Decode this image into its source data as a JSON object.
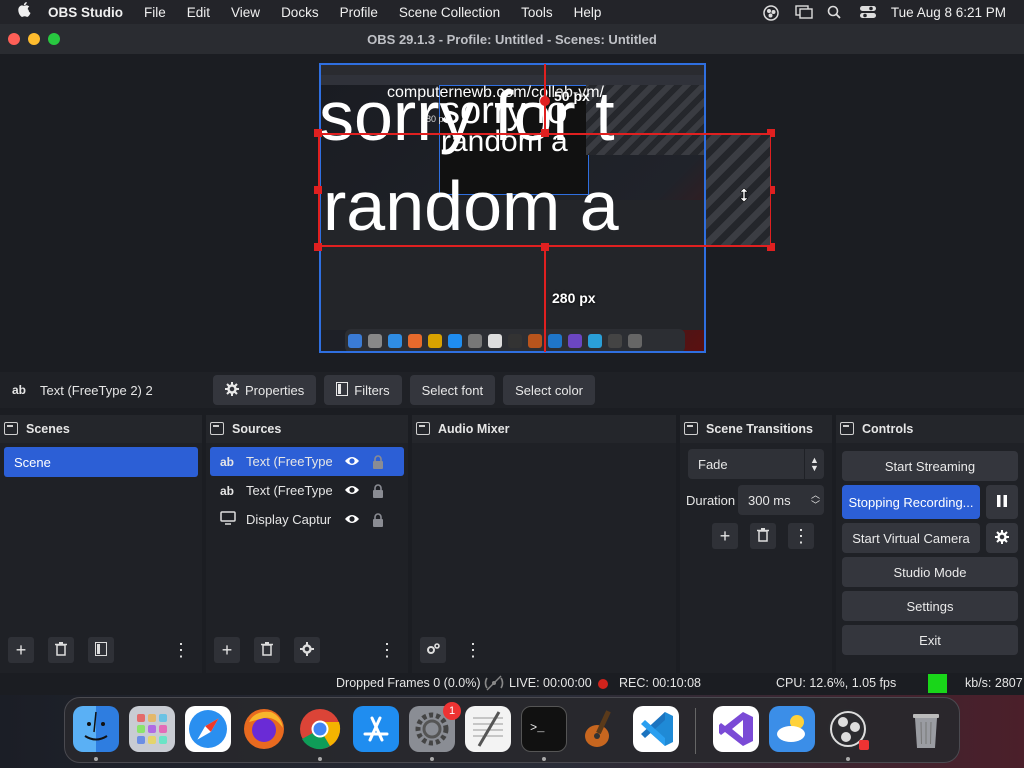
{
  "menubar": {
    "app_name": "OBS Studio",
    "items": [
      "File",
      "Edit",
      "View",
      "Docks",
      "Profile",
      "Scene Collection",
      "Tools",
      "Help"
    ],
    "clock": "Tue Aug 8  6:21 PM"
  },
  "window": {
    "title": "OBS 29.1.3 - Profile: Untitled - Scenes: Untitled"
  },
  "preview": {
    "text_line1": "sorry for t",
    "text_line2": "random a",
    "overlay_small": "computernewb.com/collab-vm/",
    "overlay_mid1": "sorry fo",
    "overlay_mid2": "random a",
    "label_top_px": "50 px",
    "label_bottom_px": "280 px",
    "mini_label_px": "280 px"
  },
  "source_toolbar": {
    "source_icon": "ab",
    "source_name": "Text (FreeType 2) 2",
    "properties_label": "Properties",
    "filters_label": "Filters",
    "select_font_label": "Select font",
    "select_color_label": "Select color"
  },
  "scenes": {
    "title": "Scenes",
    "items": [
      {
        "label": "Scene"
      }
    ]
  },
  "sources": {
    "title": "Sources",
    "items": [
      {
        "icon": "ab",
        "label": "Text (FreeType"
      },
      {
        "icon": "ab",
        "label": "Text (FreeType"
      },
      {
        "icon": "monitor",
        "label": "Display Captur"
      }
    ]
  },
  "audio_mixer": {
    "title": "Audio Mixer"
  },
  "scene_transitions": {
    "title": "Scene Transitions",
    "transition": "Fade",
    "duration_label": "Duration",
    "duration_value": "300 ms"
  },
  "controls": {
    "title": "Controls",
    "start_streaming": "Start Streaming",
    "stopping_recording": "Stopping Recording...",
    "start_virtual_camera": "Start Virtual Camera",
    "studio_mode": "Studio Mode",
    "settings": "Settings",
    "exit": "Exit"
  },
  "status": {
    "dropped_frames": "Dropped Frames 0 (0.0%)",
    "live": "LIVE: 00:00:00",
    "rec": "REC: 00:10:08",
    "cpu": "CPU: 12.6%, 1.05 fps",
    "kbs": "kb/s: 2807"
  },
  "dock": {
    "apps": [
      "finder",
      "launchpad",
      "safari",
      "firefox",
      "chrome",
      "app-store",
      "system-settings",
      "textedit",
      "terminal",
      "garageband",
      "vscode",
      "visual-studio",
      "weather",
      "obs",
      "trash"
    ],
    "settings_badge": "1"
  },
  "colors": {
    "accent": "#2c5fd6",
    "selection": "#e02020",
    "status_green": "#19d619",
    "rec_red": "#d0231c"
  }
}
